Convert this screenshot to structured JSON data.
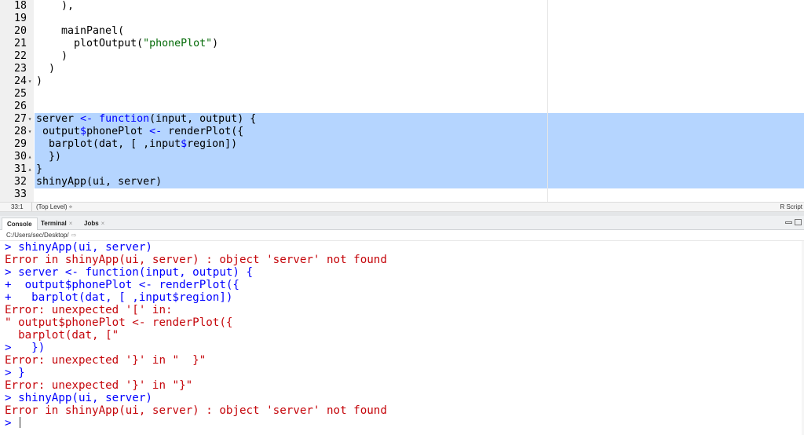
{
  "editor": {
    "lines": [
      {
        "num": "18",
        "fold": "",
        "text": "    ),",
        "selected": false
      },
      {
        "num": "19",
        "fold": "",
        "text": "",
        "selected": false
      },
      {
        "num": "20",
        "fold": "",
        "text": "    mainPanel(",
        "selected": false
      },
      {
        "num": "21",
        "fold": "",
        "text": "      plotOutput(\"phonePlot\")",
        "selected": false
      },
      {
        "num": "22",
        "fold": "",
        "text": "    )",
        "selected": false
      },
      {
        "num": "23",
        "fold": "",
        "text": "  )",
        "selected": false
      },
      {
        "num": "24",
        "fold": "▾",
        "text": ")",
        "selected": false
      },
      {
        "num": "25",
        "fold": "",
        "text": "",
        "selected": false
      },
      {
        "num": "26",
        "fold": "",
        "text": "",
        "selected": false
      },
      {
        "num": "27",
        "fold": "▾",
        "text": "server <- function(input, output) {",
        "selected": true
      },
      {
        "num": "28",
        "fold": "▾",
        "text": " output$phonePlot <- renderPlot({",
        "selected": true
      },
      {
        "num": "29",
        "fold": "",
        "text": "  barplot(dat, [ ,input$region])",
        "selected": true
      },
      {
        "num": "30",
        "fold": "▴",
        "text": "  })",
        "selected": true
      },
      {
        "num": "31",
        "fold": "▴",
        "text": "}",
        "selected": true
      },
      {
        "num": "32",
        "fold": "",
        "text": "shinyApp(ui, server)",
        "selected": true
      },
      {
        "num": "33",
        "fold": "",
        "text": "",
        "selected": false
      }
    ]
  },
  "status_bar": {
    "position": "33:1",
    "scope": "(Top Level) ÷",
    "language": "R Script"
  },
  "console_pane": {
    "tabs": [
      {
        "label": "Console",
        "close": ""
      },
      {
        "label": "Terminal",
        "close": "×"
      },
      {
        "label": "Jobs",
        "close": "×"
      }
    ],
    "working_dir": "C:/Users/sec/Desktop/",
    "path_arrow": "⇨"
  },
  "console": {
    "lines": [
      {
        "text": "> shinyApp(ui, server)",
        "kind": "in"
      },
      {
        "text": "Error in shinyApp(ui, server) : object 'server' not found",
        "kind": "err"
      },
      {
        "text": "> server <- function(input, output) {",
        "kind": "in"
      },
      {
        "text": "+  output$phonePlot <- renderPlot({",
        "kind": "in"
      },
      {
        "text": "+   barplot(dat, [ ,input$region])",
        "kind": "in"
      },
      {
        "text": "Error: unexpected '[' in:",
        "kind": "err"
      },
      {
        "text": "\" output$phonePlot <- renderPlot({",
        "kind": "err"
      },
      {
        "text": "  barplot(dat, [\"",
        "kind": "err"
      },
      {
        "text": ">   })",
        "kind": "in"
      },
      {
        "text": "Error: unexpected '}' in \"  }\"",
        "kind": "err"
      },
      {
        "text": "> }",
        "kind": "in"
      },
      {
        "text": "Error: unexpected '}' in \"}\"",
        "kind": "err"
      },
      {
        "text": "> shinyApp(ui, server)",
        "kind": "in"
      },
      {
        "text": "Error in shinyApp(ui, server) : object 'server' not found",
        "kind": "err"
      },
      {
        "text": "> ",
        "kind": "in"
      }
    ]
  },
  "colors": {
    "selection": "#b5d5ff",
    "console_input": "#0000ff",
    "console_error": "#c5060b",
    "string": "#036a07"
  }
}
